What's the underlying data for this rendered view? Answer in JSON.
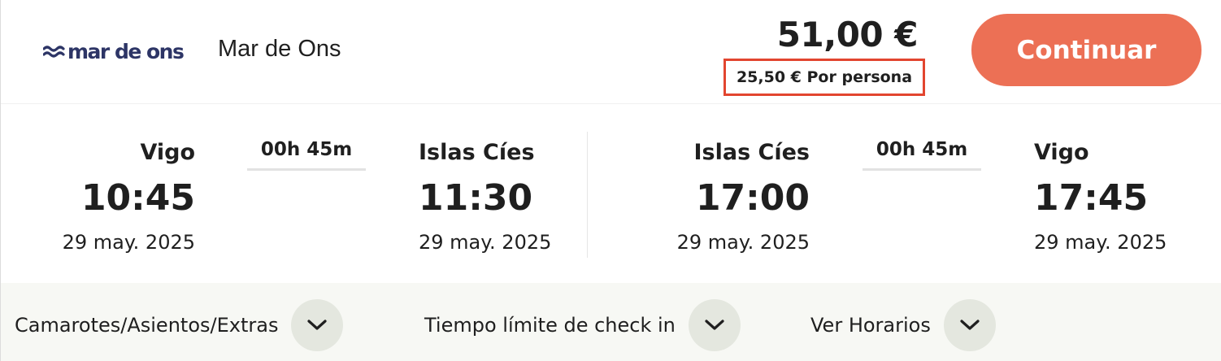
{
  "operator": {
    "logo_text": "mar de ons",
    "name": "Mar de Ons"
  },
  "price": {
    "total": "51,00 €",
    "per_person": "25,50 € Por persona"
  },
  "actions": {
    "continue_label": "Continuar"
  },
  "outbound": {
    "origin_city": "Vigo",
    "departure_time": "10:45",
    "departure_date": "29 may. 2025",
    "duration": "00h 45m",
    "destination_city": "Islas Cíes",
    "arrival_time": "11:30",
    "arrival_date": "29 may. 2025"
  },
  "return": {
    "origin_city": "Islas Cíes",
    "departure_time": "17:00",
    "departure_date": "29 may. 2025",
    "duration": "00h 45m",
    "destination_city": "Vigo",
    "arrival_time": "17:45",
    "arrival_date": "29 may. 2025"
  },
  "footer": {
    "items": [
      {
        "label": "Camarotes/Asientos/Extras",
        "icon": "chevron-down-icon"
      },
      {
        "label": "Tiempo límite de check in",
        "icon": "chevron-down-icon"
      },
      {
        "label": "Ver Horarios",
        "icon": "chevron-down-icon"
      }
    ]
  },
  "colors": {
    "accent": "#ec7055",
    "highlight_border": "#e2452f",
    "logo": "#2d3566",
    "footer_bg": "#f7f8f4",
    "chevron_bg": "#e4e7df"
  }
}
